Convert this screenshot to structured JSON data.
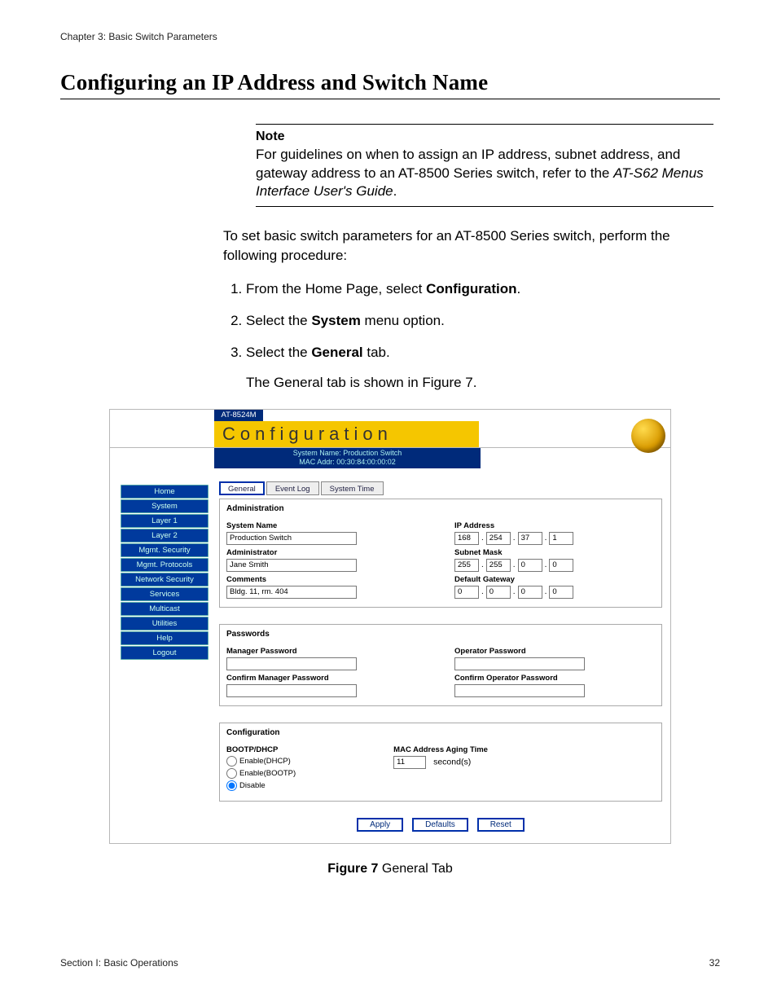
{
  "header": {
    "chapter_line": "Chapter 3: Basic Switch Parameters",
    "h1": "Configuring an IP Address and Switch Name"
  },
  "note": {
    "title": "Note",
    "body_pre": "For guidelines on when to assign an IP address, subnet address, and gateway address to an AT-8500 Series switch, refer to the ",
    "ref_title": "AT-S62 Menus Interface User's Guide",
    "body_post": "."
  },
  "intro_para": "To set basic switch parameters for an AT-8500 Series switch, perform the following procedure:",
  "steps": [
    {
      "pre": "From the Home Page, select ",
      "bold": "Configuration",
      "post": "."
    },
    {
      "pre": "Select the ",
      "bold": "System",
      "post": " menu option."
    },
    {
      "pre": "Select the ",
      "bold": "General",
      "post": " tab.",
      "sub": "The General tab is shown in Figure 7."
    }
  ],
  "figure": {
    "model": "AT-8524M",
    "title": "Configuration",
    "sys_line1": "System Name: Production Switch",
    "sys_line2": "MAC Addr: 00:30:84:00:00:02",
    "nav": [
      "Home",
      "System",
      "Layer 1",
      "Layer 2",
      "Mgmt. Security",
      "Mgmt. Protocols",
      "Network Security",
      "Services",
      "Multicast",
      "Utilities",
      "Help",
      "Logout"
    ],
    "tabs": [
      "General",
      "Event Log",
      "System Time"
    ],
    "selected_tab": "General",
    "admin": {
      "section": "Administration",
      "system_name_label": "System Name",
      "system_name": "Production Switch",
      "administrator_label": "Administrator",
      "administrator": "Jane Smith",
      "comments_label": "Comments",
      "comments": "Bldg. 11, rm. 404",
      "ip_label": "IP Address",
      "ip": [
        "168",
        "254",
        "37",
        "1"
      ],
      "mask_label": "Subnet Mask",
      "mask": [
        "255",
        "255",
        "0",
        "0"
      ],
      "gw_label": "Default Gateway",
      "gw": [
        "0",
        "0",
        "0",
        "0"
      ]
    },
    "passwords": {
      "section": "Passwords",
      "mgr_label": "Manager Password",
      "mgr_conf_label": "Confirm Manager Password",
      "op_label": "Operator Password",
      "op_conf_label": "Confirm Operator Password"
    },
    "config": {
      "section": "Configuration",
      "bootp_label": "BOOTP/DHCP",
      "options": [
        "Enable(DHCP)",
        "Enable(BOOTP)",
        "Disable"
      ],
      "selected": "Disable",
      "aging_label": "MAC Address Aging Time",
      "aging_value": "11",
      "aging_unit": "second(s)"
    },
    "buttons": [
      "Apply",
      "Defaults",
      "Reset"
    ],
    "caption_bold": "Figure 7",
    "caption_rest": "  General Tab"
  },
  "footer": {
    "left": "Section I: Basic Operations",
    "right": "32"
  }
}
